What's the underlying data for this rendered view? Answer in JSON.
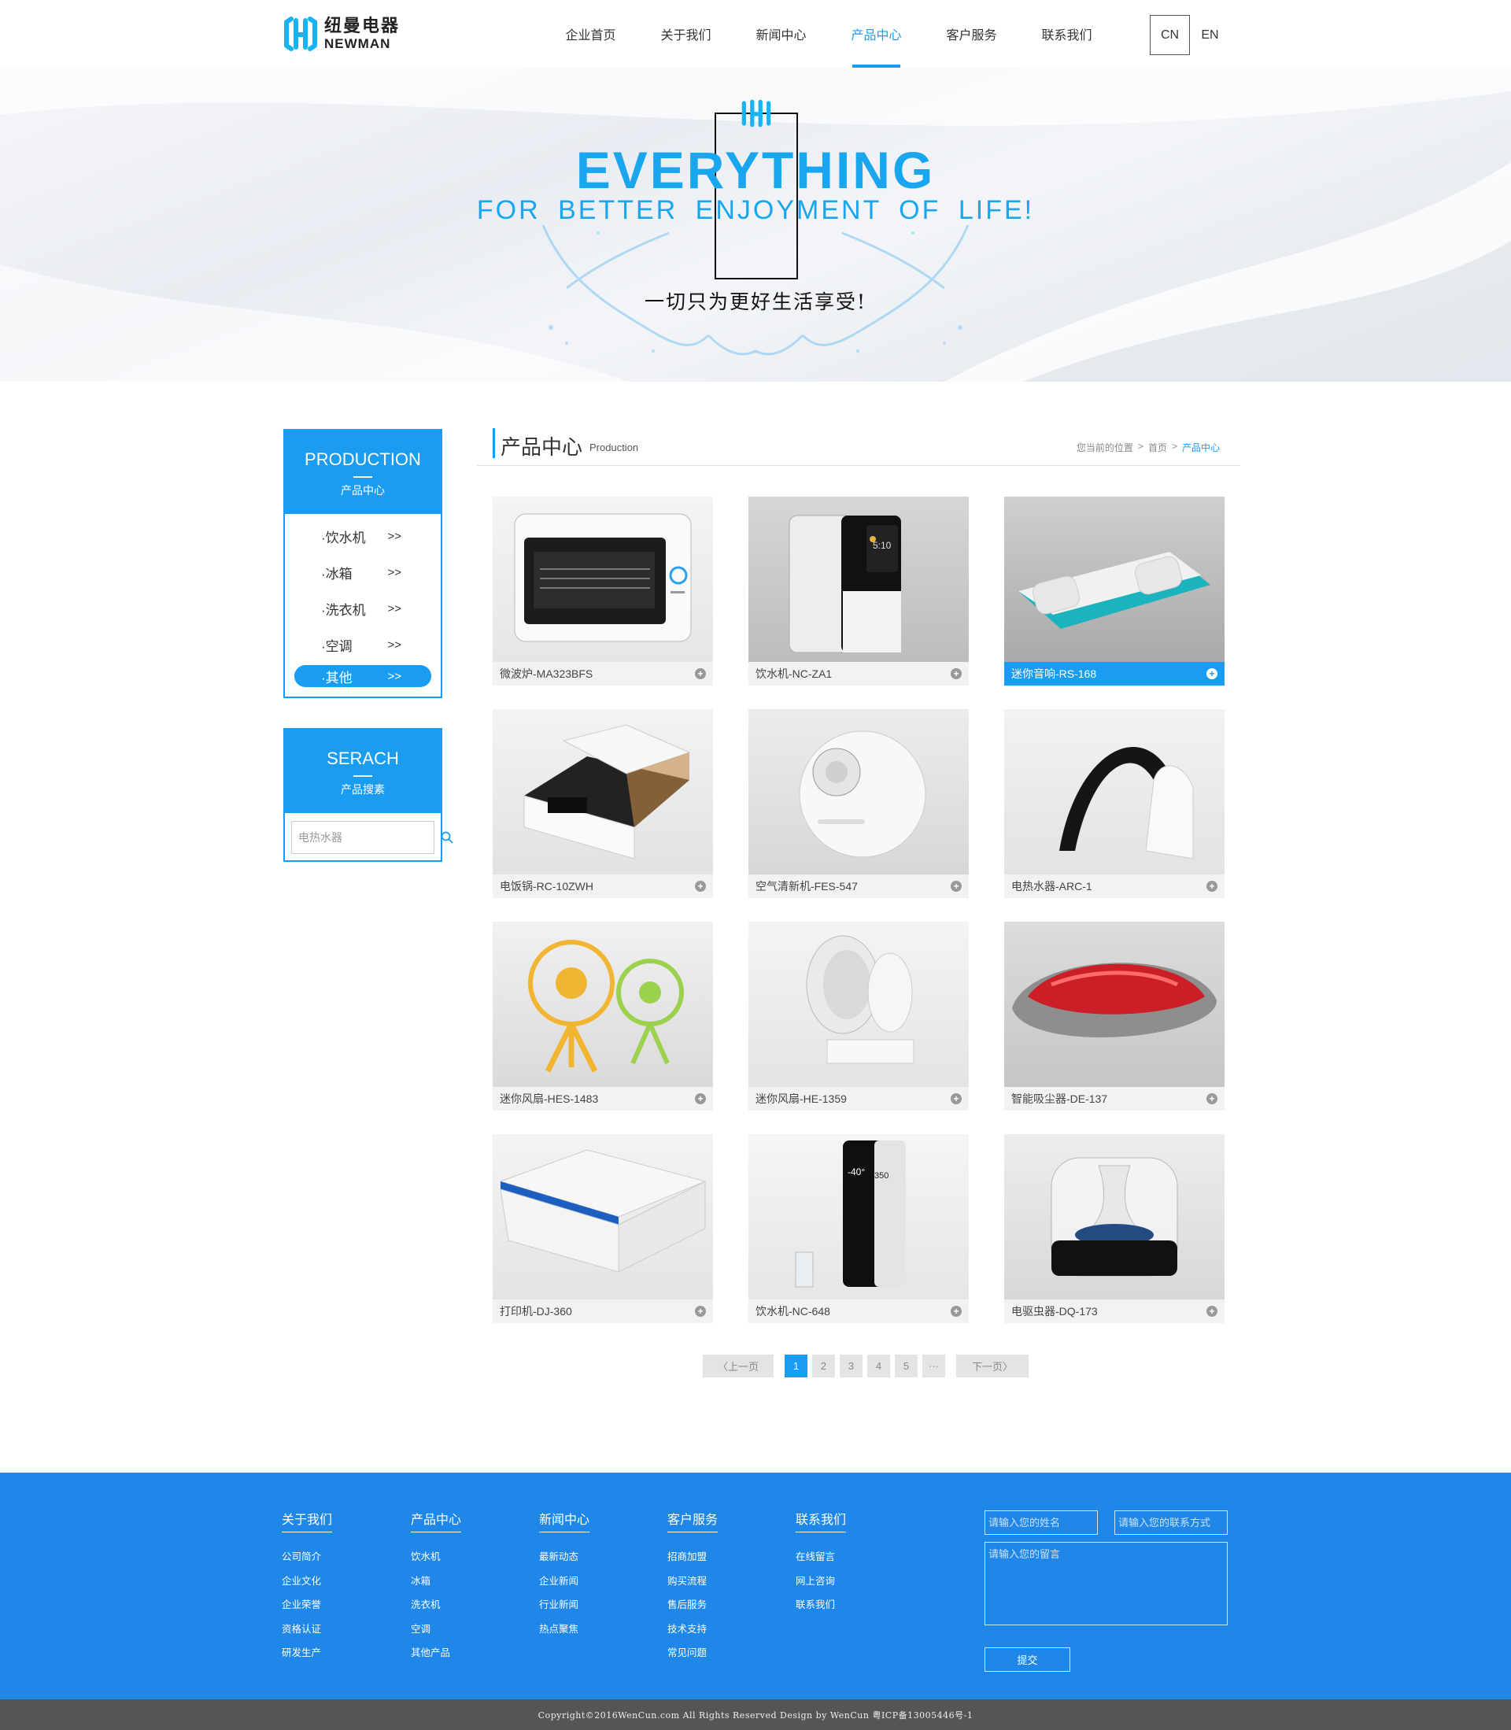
{
  "header": {
    "logo_cn": "纽曼电器",
    "logo_en": "NEWMAN",
    "nav": [
      "企业首页",
      "关于我们",
      "新闻中心",
      "产品中心",
      "客户服务",
      "联系我们"
    ],
    "nav_active": "产品中心",
    "lang": [
      "CN",
      "EN"
    ],
    "lang_active": "CN"
  },
  "banner": {
    "title": "EVERYTHING",
    "subtitle": "FOR BETTER ENJOYMENT OF LIFE!",
    "slogan_cn": "一切只为更好生活享受!"
  },
  "sidebar": {
    "category_title_en": "PRODUCTION",
    "category_title_cn": "产品中心",
    "categories": [
      {
        "label": "·饮水机",
        "arrow": ">>"
      },
      {
        "label": "·冰箱",
        "arrow": ">>"
      },
      {
        "label": "·洗衣机",
        "arrow": ">>"
      },
      {
        "label": "·空调",
        "arrow": ">>"
      },
      {
        "label": "·其他",
        "arrow": ">>"
      }
    ],
    "active_category": "·其他",
    "search_title_en": "SERACH",
    "search_title_cn": "产品搜素",
    "search_placeholder": "电热水器"
  },
  "main": {
    "title": "产品中心",
    "title_en": "Production",
    "breadcrumb": [
      "您当前的位置",
      ">",
      "首页",
      ">",
      "产品中心"
    ],
    "products": [
      {
        "name": "微波炉-MA323BFS",
        "icon": "oven-image"
      },
      {
        "name": "饮水机-NC-ZA1",
        "icon": "water-dispenser-image"
      },
      {
        "name": "迷你音响-RS-168",
        "icon": "mini-speaker-image"
      },
      {
        "name": "电饭锅-RC-10ZWH",
        "icon": "rice-cooker-image"
      },
      {
        "name": "空气清新机-FES-547",
        "icon": "air-purifier-image"
      },
      {
        "name": "电热水器-ARC-1",
        "icon": "water-heater-image"
      },
      {
        "name": "迷你风扇-HES-1483",
        "icon": "mini-fans-image"
      },
      {
        "name": "迷你风扇-HE-1359",
        "icon": "desk-fan-image"
      },
      {
        "name": "智能吸尘器-DE-137",
        "icon": "robot-vacuum-image"
      },
      {
        "name": "打印机-DJ-360",
        "icon": "printer-image"
      },
      {
        "name": "饮水机-NC-648",
        "icon": "water-dispenser-image"
      },
      {
        "name": "电驱虫器-DQ-173",
        "icon": "bug-repeller-image"
      }
    ],
    "active_product": "迷你音响-RS-168",
    "plus": "+"
  },
  "pagination": {
    "prev": "〈上一页",
    "pages": [
      "1",
      "2",
      "3",
      "4",
      "5",
      "···"
    ],
    "current": "1",
    "next": "下一页〉"
  },
  "footer": {
    "columns": [
      {
        "title": "关于我们",
        "items": [
          "公司简介",
          "企业文化",
          "企业荣誉",
          "资格认证",
          "研发生产"
        ]
      },
      {
        "title": "产品中心",
        "items": [
          "饮水机",
          "冰箱",
          "洗衣机",
          "空调",
          "其他产品"
        ]
      },
      {
        "title": "新闻中心",
        "items": [
          "最新动态",
          "企业新闻",
          "行业新闻",
          "热点聚焦"
        ]
      },
      {
        "title": "客户服务",
        "items": [
          "招商加盟",
          "购买流程",
          "售后服务",
          "技术支持",
          "常见问题"
        ]
      },
      {
        "title": "联系我们",
        "items": [
          "在线留言",
          "网上咨询",
          "联系我们"
        ]
      }
    ],
    "form": {
      "name_placeholder": "请输入您的姓名",
      "contact_placeholder": "请输入您的联系方式",
      "message_placeholder": "请输入您的留言",
      "submit": "提交"
    },
    "copyright": "Copyright©2016WenCun.com All Rights Reserved Design by WenCun 粤ICP备13005446号-1"
  },
  "colors": {
    "accent": "#1a9cf1",
    "footer": "#1f87e8",
    "copyright_bar": "#555555"
  }
}
